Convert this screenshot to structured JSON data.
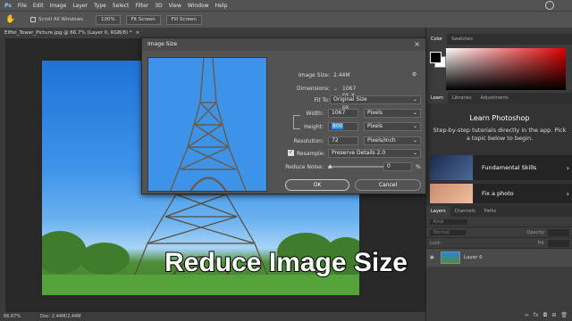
{
  "menubar": {
    "items": [
      "File",
      "Edit",
      "Image",
      "Layer",
      "Type",
      "Select",
      "Filter",
      "3D",
      "View",
      "Window",
      "Help"
    ]
  },
  "options": {
    "scroll_all": "Scroll All Windows",
    "zoom": "100%",
    "fit": "Fit Screen",
    "fill": "Fill Screen"
  },
  "document": {
    "tab_title": "Eiffel_Tower_Picture.jpg @ 66.7% (Layer 0, RGB/8) *",
    "zoom": "66.67%",
    "doc_info": "Doc: 2.44M/2.44M"
  },
  "dialog": {
    "title": "Image Size",
    "image_size_label": "Image Size:",
    "image_size_value": "2.44M",
    "dimensions_label": "Dimensions:",
    "dimensions_value": "1067 px  ×  800 px",
    "fit_to_label": "Fit To:",
    "fit_to_value": "Original Size",
    "width_label": "Width:",
    "width_value": "1067",
    "width_unit": "Pixels",
    "height_label": "Height:",
    "height_value": "800",
    "height_unit": "Pixels",
    "resolution_label": "Resolution:",
    "resolution_value": "72",
    "resolution_unit": "Pixels/Inch",
    "resample_label": "Resample:",
    "resample_value": "Preserve Details 2.0",
    "noise_label": "Reduce Noise:",
    "noise_value": "0",
    "noise_unit": "%",
    "ok": "OK",
    "cancel": "Cancel"
  },
  "color_panel": {
    "tabs": [
      "Color",
      "Swatches"
    ]
  },
  "learn_panel": {
    "tabs": [
      "Learn",
      "Libraries",
      "Adjustments"
    ],
    "title": "Learn Photoshop",
    "description": "Step-by-step tutorials directly in the app. Pick a topic below to begin.",
    "cards": [
      "Fundamental Skills",
      "Fix a photo"
    ]
  },
  "layers_panel": {
    "tabs": [
      "Layers",
      "Channels",
      "Paths"
    ],
    "kind": "Kind",
    "mode": "Normal",
    "opacity_label": "Opacity:",
    "fill_label": "Fill:",
    "lock_label": "Lock:",
    "layer_name": "Layer 0"
  },
  "caption": "Reduce Image Size",
  "colors": {
    "accent": "#2d8ceb",
    "panel": "#535353",
    "dark": "#282828"
  }
}
